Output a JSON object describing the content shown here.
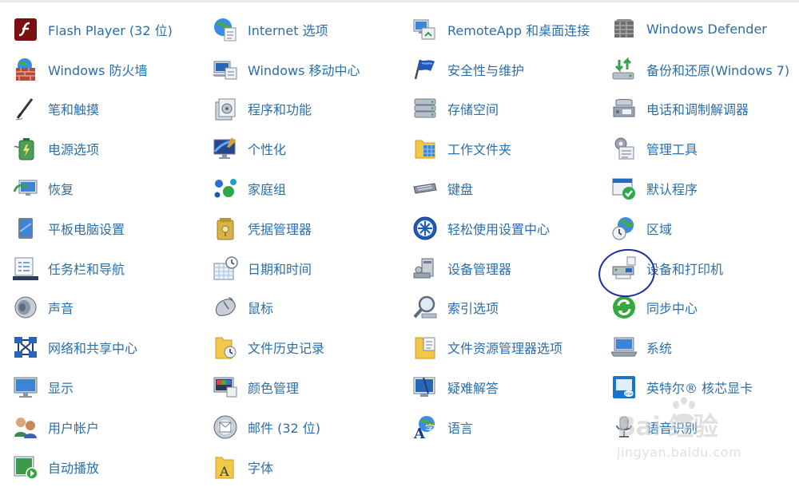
{
  "items": [
    {
      "label": "Flash Player (32 位)",
      "icon": "flash-player-icon"
    },
    {
      "label": "Internet 选项",
      "icon": "internet-options-icon"
    },
    {
      "label": "RemoteApp 和桌面连接",
      "icon": "remoteapp-icon"
    },
    {
      "label": "Windows Defender",
      "icon": "windows-defender-icon"
    },
    {
      "label": "Windows 防火墙",
      "icon": "firewall-icon"
    },
    {
      "label": "Windows 移动中心",
      "icon": "mobility-center-icon"
    },
    {
      "label": "安全性与维护",
      "icon": "security-flag-icon"
    },
    {
      "label": "备份和还原(Windows 7)",
      "icon": "backup-restore-icon"
    },
    {
      "label": "笔和触摸",
      "icon": "pen-icon"
    },
    {
      "label": "程序和功能",
      "icon": "programs-icon"
    },
    {
      "label": "存储空间",
      "icon": "storage-spaces-icon"
    },
    {
      "label": "电话和调制解调器",
      "icon": "phone-modem-icon"
    },
    {
      "label": "电源选项",
      "icon": "power-options-icon"
    },
    {
      "label": "个性化",
      "icon": "personalization-icon"
    },
    {
      "label": "工作文件夹",
      "icon": "work-folders-icon"
    },
    {
      "label": "管理工具",
      "icon": "admin-tools-icon"
    },
    {
      "label": "恢复",
      "icon": "recovery-icon"
    },
    {
      "label": "家庭组",
      "icon": "homegroup-icon"
    },
    {
      "label": "键盘",
      "icon": "keyboard-icon"
    },
    {
      "label": "默认程序",
      "icon": "default-programs-icon"
    },
    {
      "label": "平板电脑设置",
      "icon": "tablet-settings-icon"
    },
    {
      "label": "凭据管理器",
      "icon": "credential-manager-icon"
    },
    {
      "label": "轻松使用设置中心",
      "icon": "ease-of-access-icon"
    },
    {
      "label": "区域",
      "icon": "region-icon"
    },
    {
      "label": "任务栏和导航",
      "icon": "taskbar-icon"
    },
    {
      "label": "日期和时间",
      "icon": "date-time-icon"
    },
    {
      "label": "设备管理器",
      "icon": "device-manager-icon"
    },
    {
      "label": "设备和打印机",
      "icon": "printer-icon"
    },
    {
      "label": "声音",
      "icon": "sound-icon"
    },
    {
      "label": "鼠标",
      "icon": "mouse-icon"
    },
    {
      "label": "索引选项",
      "icon": "indexing-icon"
    },
    {
      "label": "同步中心",
      "icon": "sync-center-icon"
    },
    {
      "label": "网络和共享中心",
      "icon": "network-icon"
    },
    {
      "label": "文件历史记录",
      "icon": "file-history-icon"
    },
    {
      "label": "文件资源管理器选项",
      "icon": "explorer-options-icon"
    },
    {
      "label": "系统",
      "icon": "system-icon"
    },
    {
      "label": "显示",
      "icon": "display-icon"
    },
    {
      "label": "颜色管理",
      "icon": "color-management-icon"
    },
    {
      "label": "疑难解答",
      "icon": "troubleshooting-icon"
    },
    {
      "label": "英特尔® 核芯显卡",
      "icon": "intel-graphics-icon"
    },
    {
      "label": "用户帐户",
      "icon": "user-accounts-icon"
    },
    {
      "label": "邮件 (32 位)",
      "icon": "mail-icon"
    },
    {
      "label": "语言",
      "icon": "language-icon"
    },
    {
      "label": "语音识别",
      "icon": "speech-recognition-icon"
    },
    {
      "label": "自动播放",
      "icon": "autoplay-icon"
    },
    {
      "label": "字体",
      "icon": "fonts-icon"
    }
  ],
  "watermark": {
    "brand": "Bai 经验",
    "url": "jingyan.baidu.com"
  }
}
